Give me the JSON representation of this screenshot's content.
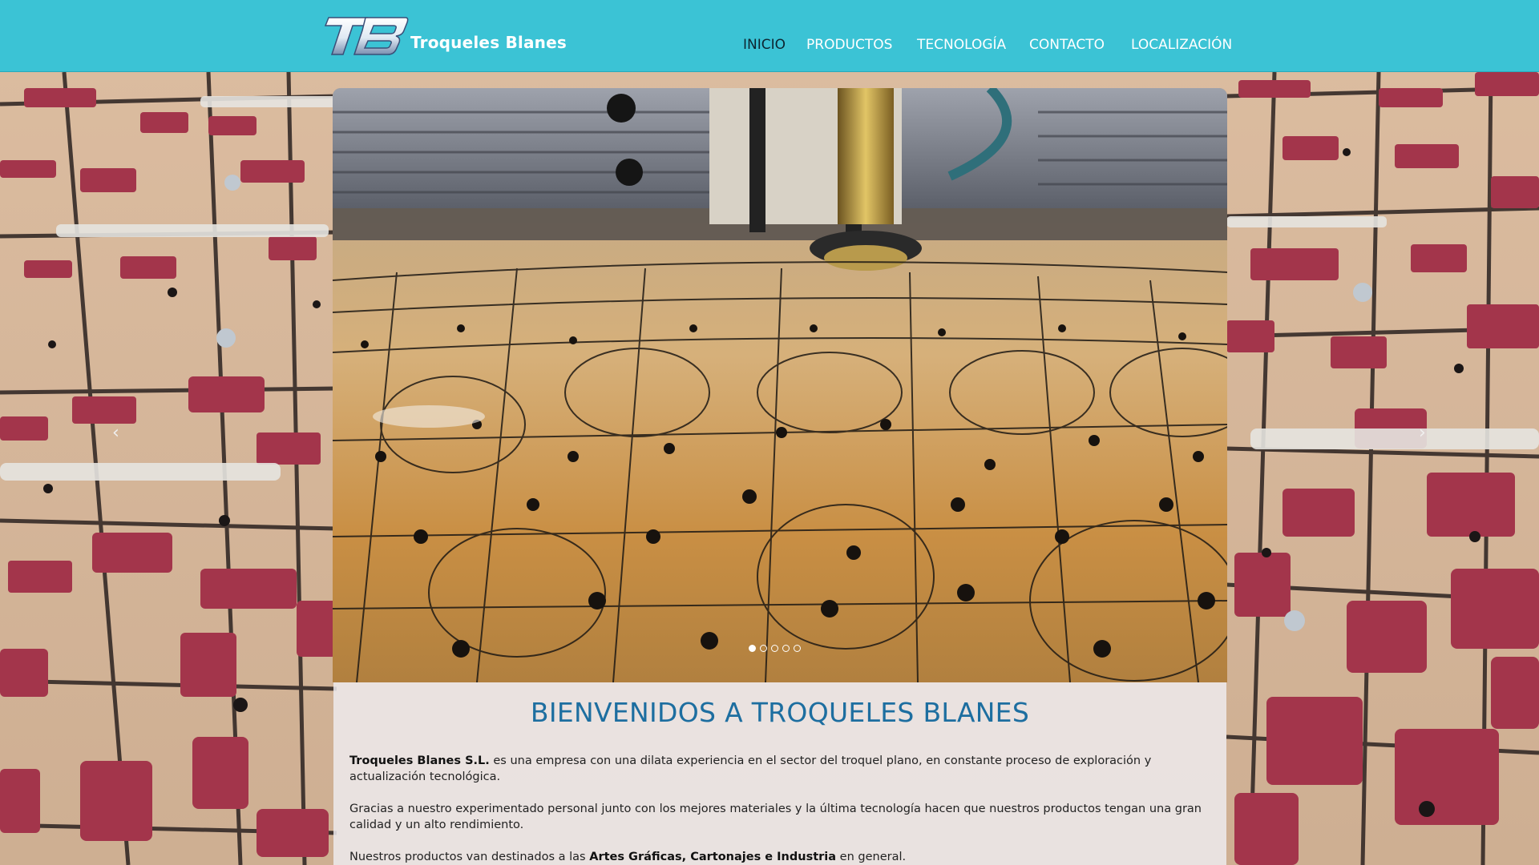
{
  "brand": {
    "name": "Troqueles Blanes",
    "monogram": "TB"
  },
  "nav": {
    "items": [
      {
        "label": "INICIO",
        "active": true
      },
      {
        "label": "PRODUCTOS",
        "active": false
      },
      {
        "label": "TECNOLOGÍA",
        "active": false
      },
      {
        "label": "CONTACTO",
        "active": false
      },
      {
        "label": "LOCALIZACIÓN",
        "active": false
      }
    ]
  },
  "slider": {
    "prev_label": "‹",
    "next_label": "›",
    "slide_count": 5,
    "active_slide": 1
  },
  "content": {
    "heading": "BIENVENIDOS A TROQUELES BLANES",
    "p1_bold": "Troqueles Blanes S.L.",
    "p1_rest": " es una empresa con una dilata experiencia en el sector del troquel plano, en constante proceso de exploración y actualización tecnológica.",
    "p2": "Gracias a nuestro experimentado personal junto con los mejores materiales y la última tecnología hacen que nuestros productos tengan una gran calidad y un alto rendimiento.",
    "p3_start": "Nuestros productos van destinados a las ",
    "p3_bold": "Artes Gráficas, Cartonajes e Industria",
    "p3_end": " en general."
  },
  "colors": {
    "header_bg": "#3bc3d5",
    "heading": "#1d6ea0",
    "nav_active": "#0d2530",
    "nav_text": "#ffffff"
  }
}
